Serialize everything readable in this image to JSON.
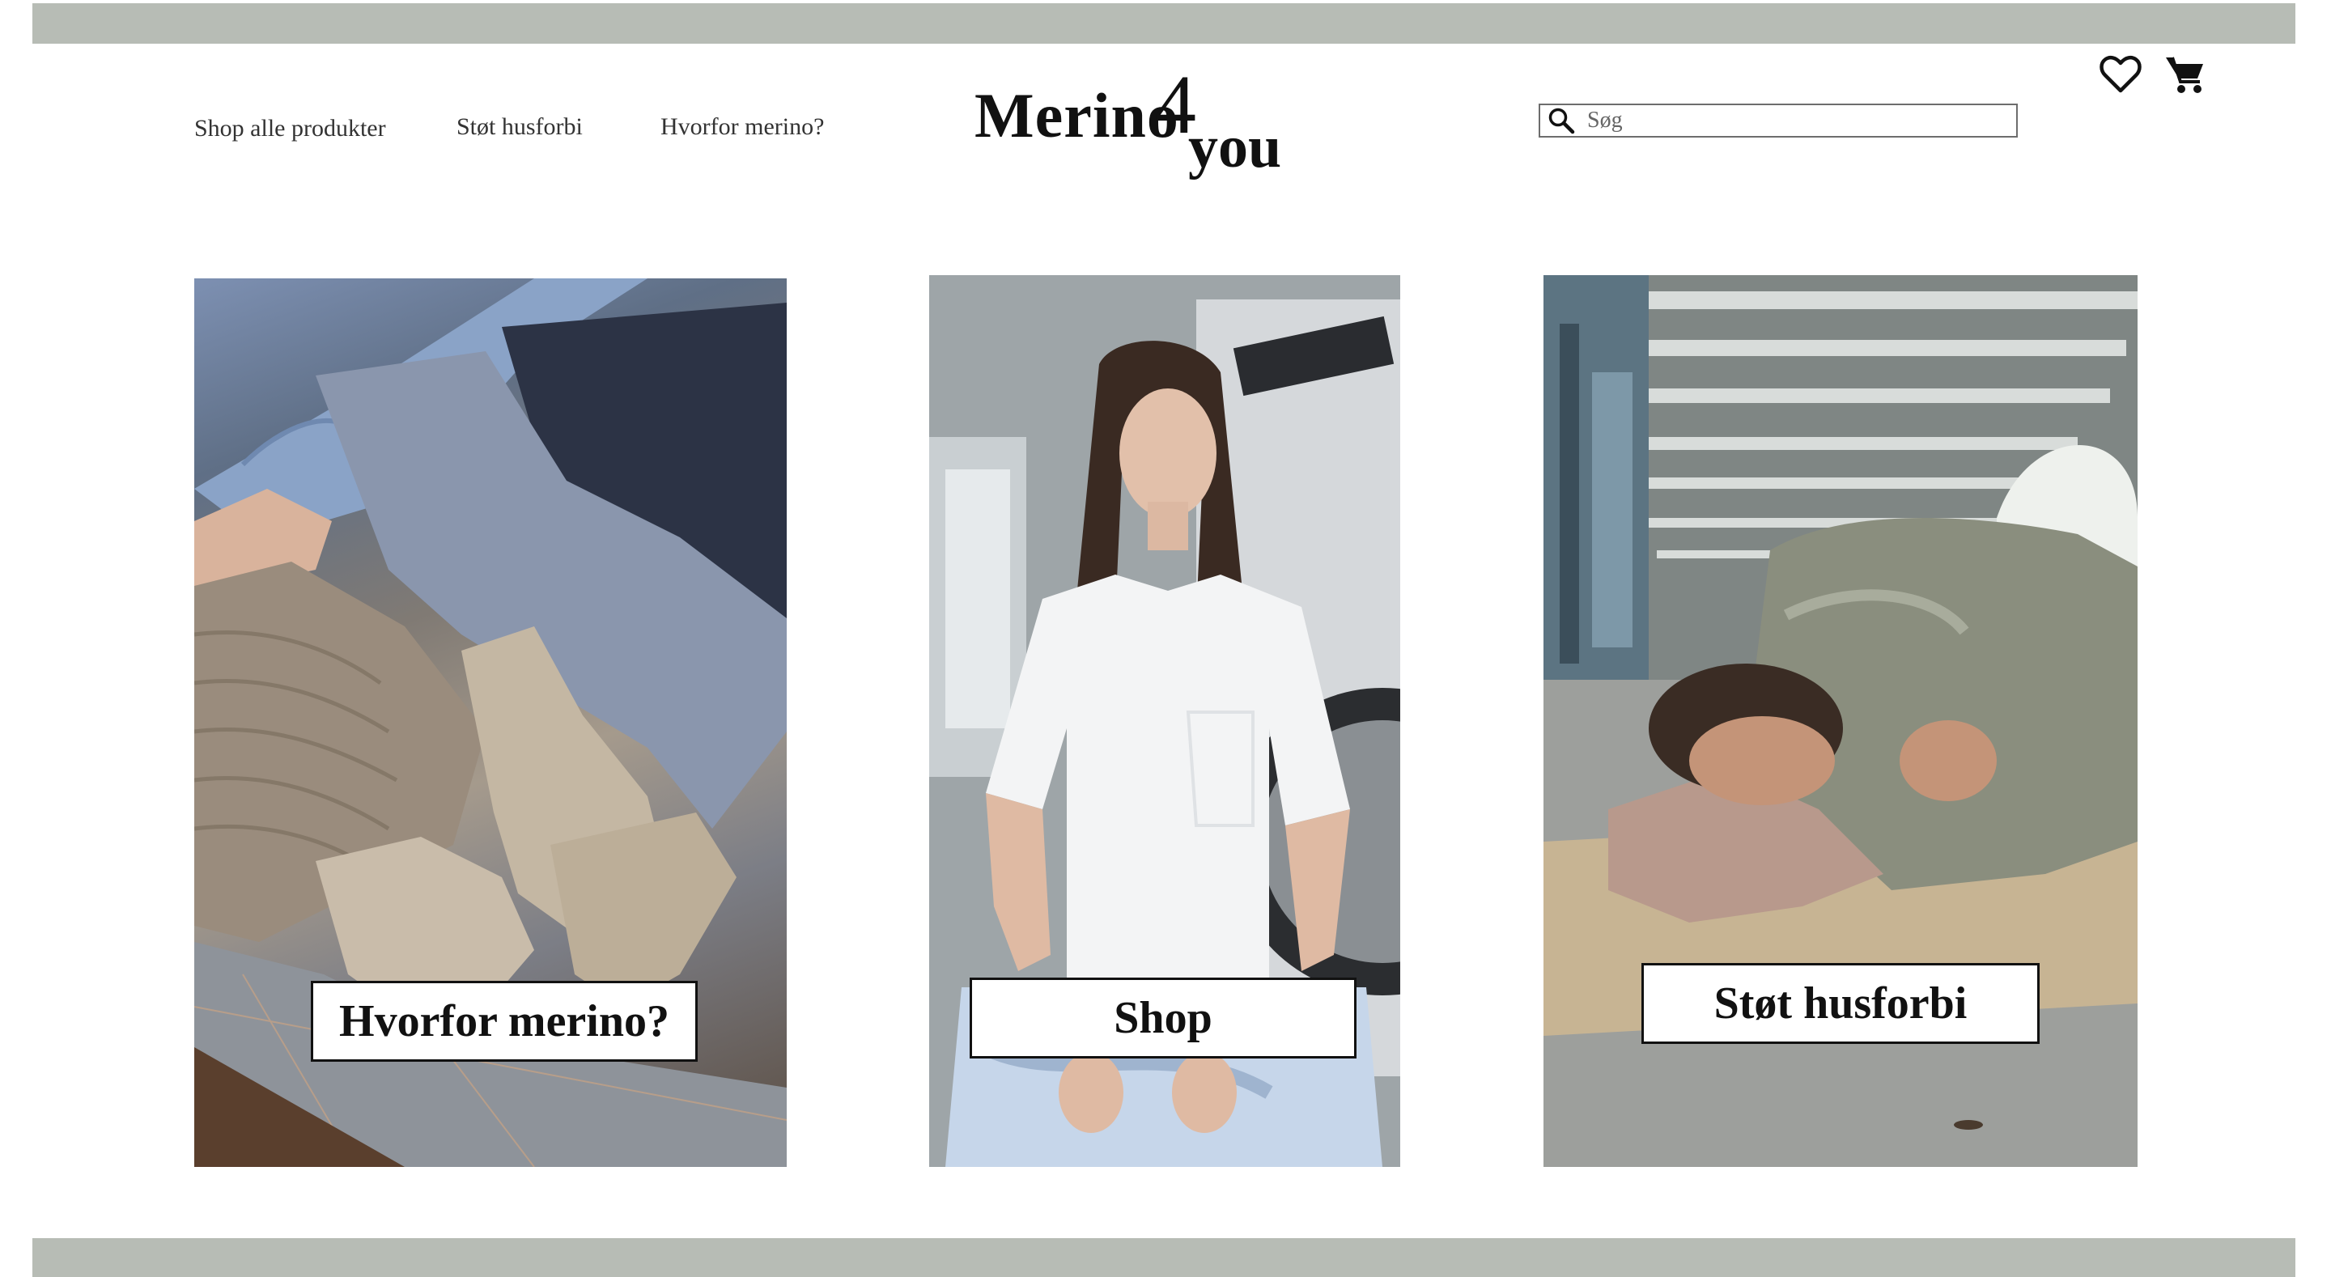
{
  "header": {
    "nav": [
      {
        "label": "Shop alle produkter"
      },
      {
        "label": "Støt husforbi"
      },
      {
        "label": "Hvorfor merino?"
      }
    ],
    "logo": {
      "part1": "Merino",
      "part2": "4",
      "part3": "you"
    },
    "search": {
      "placeholder": "Søg",
      "value": ""
    },
    "icons": {
      "wishlist": "heart-icon",
      "cart": "cart-icon",
      "search": "search-icon"
    }
  },
  "cards": [
    {
      "label": "Hvorfor merino?",
      "image": "socks-photo"
    },
    {
      "label": "Shop",
      "image": "woman-white-tshirt-photo"
    },
    {
      "label": "Støt husforbi",
      "image": "homeless-man-photo"
    }
  ],
  "colors": {
    "band": "#b7bcb5",
    "text": "#111111",
    "background": "#ffffff"
  }
}
